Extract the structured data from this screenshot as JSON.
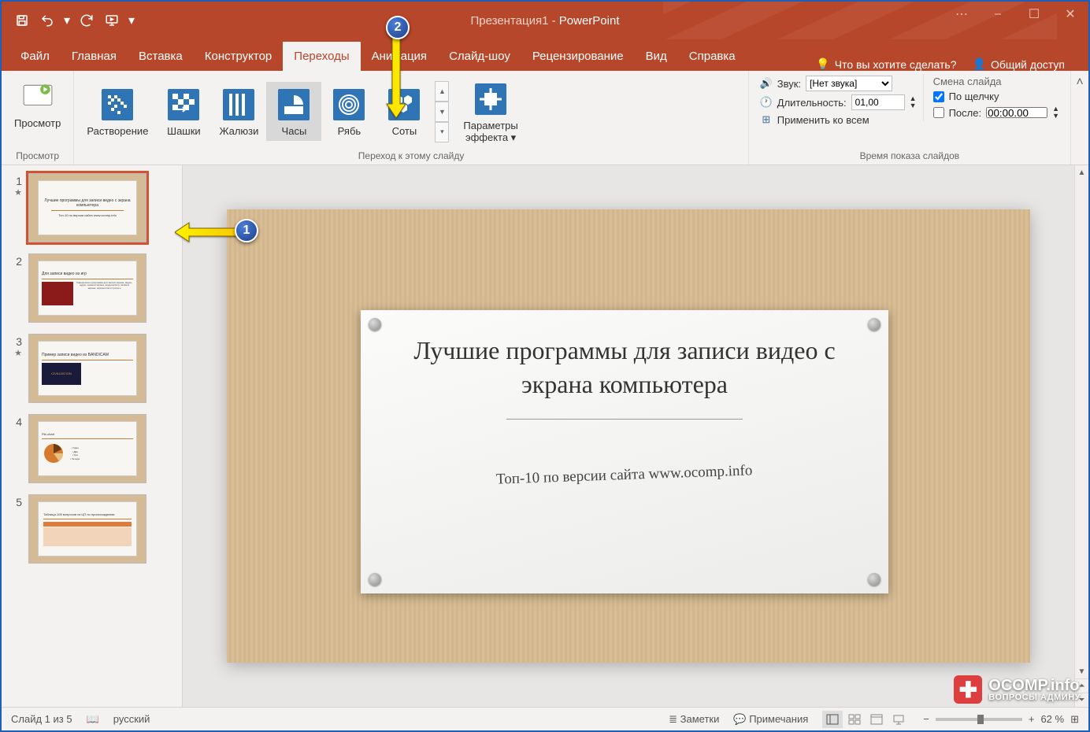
{
  "title": {
    "doc": "Презентация1",
    "app": "PowerPoint"
  },
  "tabs": {
    "file": "Файл",
    "home": "Главная",
    "insert": "Вставка",
    "design": "Конструктор",
    "transitions": "Переходы",
    "animations": "Анимация",
    "slideshow": "Слайд-шоу",
    "review": "Рецензирование",
    "view": "Вид",
    "help": "Справка",
    "search": "Что вы хотите сделать?",
    "share": "Общий доступ"
  },
  "ribbon": {
    "preview": {
      "btn": "Просмотр",
      "group": "Просмотр"
    },
    "transitions": {
      "items": [
        "Растворение",
        "Шашки",
        "Жалюзи",
        "Часы",
        "Рябь",
        "Соты"
      ],
      "selected": "Часы",
      "group": "Переход к этому слайду"
    },
    "effect_options": "Параметры\nэффекта",
    "timing": {
      "sound_label": "Звук:",
      "sound_value": "[Нет звука]",
      "duration_label": "Длительность:",
      "duration_value": "01,00",
      "apply_all": "Применить ко всем",
      "advance_header": "Смена слайда",
      "on_click": "По щелчку",
      "after_label": "После:",
      "after_value": "00:00,00",
      "group": "Время показа слайдов"
    }
  },
  "thumbs": [
    {
      "num": "1",
      "star": true,
      "title": "Лучшие программы для записи видео с экрана компьютера",
      "sub": "Топ-10 по версии сайта www.ocomp.info"
    },
    {
      "num": "2",
      "star": false,
      "title": "Для записи видео из игр"
    },
    {
      "num": "3",
      "star": true,
      "title": "Пример записи видео из BANDICAM"
    },
    {
      "num": "4",
      "star": false,
      "title": "Pie-chart"
    },
    {
      "num": "5",
      "star": false,
      "title": "Таблица-105 вопросов из ЦП по происхождению"
    }
  ],
  "slide": {
    "title": "Лучшие программы для записи видео с экрана компьютера",
    "subtitle": "Топ-10 по версии сайта www.ocomp.info"
  },
  "status": {
    "counter": "Слайд 1 из 5",
    "lang": "русский",
    "notes": "Заметки",
    "comments": "Примечания",
    "zoom": "62 %"
  },
  "watermark": {
    "brand": "OCOMP.info",
    "tag": "ВОПРОСЫ АДМИНУ"
  },
  "callouts": {
    "c1": "1",
    "c2": "2"
  }
}
